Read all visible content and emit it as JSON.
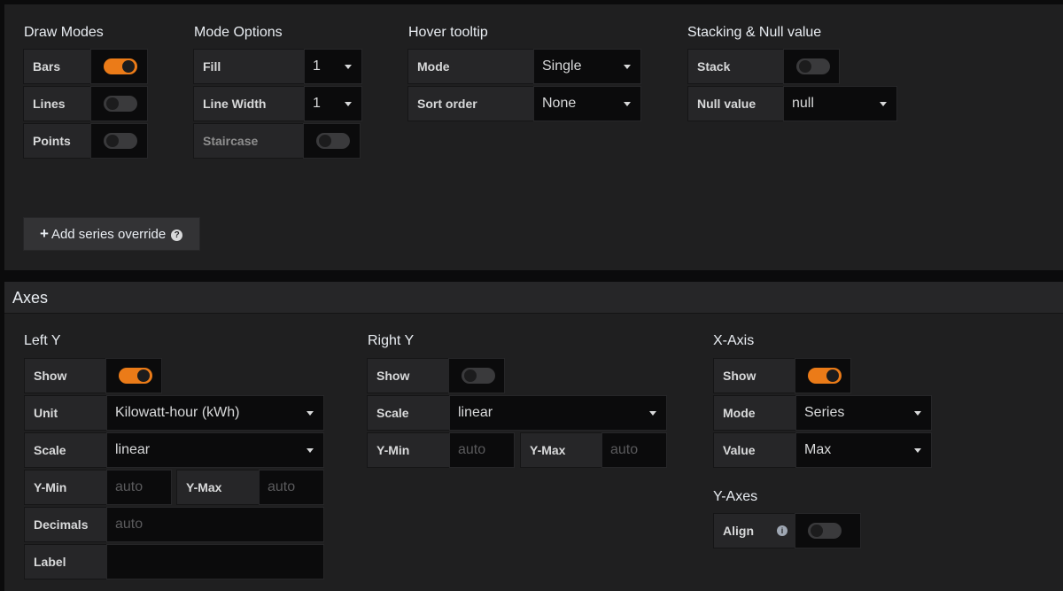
{
  "draw_modes": {
    "title": "Draw Modes",
    "bars_label": "Bars",
    "bars_on": true,
    "lines_label": "Lines",
    "lines_on": false,
    "points_label": "Points",
    "points_on": false
  },
  "mode_options": {
    "title": "Mode Options",
    "fill_label": "Fill",
    "fill_value": "1",
    "line_width_label": "Line Width",
    "line_width_value": "1",
    "staircase_label": "Staircase",
    "staircase_on": false
  },
  "hover_tooltip": {
    "title": "Hover tooltip",
    "mode_label": "Mode",
    "mode_value": "Single",
    "sort_label": "Sort order",
    "sort_value": "None"
  },
  "stacking": {
    "title": "Stacking & Null value",
    "stack_label": "Stack",
    "stack_on": false,
    "null_label": "Null value",
    "null_value": "null"
  },
  "add_override": {
    "label": "Add series override",
    "icon": "question-circle-icon"
  },
  "axes": {
    "title": "Axes",
    "left_y": {
      "title": "Left Y",
      "show_label": "Show",
      "show_on": true,
      "unit_label": "Unit",
      "unit_value": "Kilowatt-hour (kWh)",
      "scale_label": "Scale",
      "scale_value": "linear",
      "ymin_label": "Y-Min",
      "ymin_placeholder": "auto",
      "ymax_label": "Y-Max",
      "ymax_placeholder": "auto",
      "decimals_label": "Decimals",
      "decimals_placeholder": "auto",
      "label_label": "Label",
      "label_value": ""
    },
    "right_y": {
      "title": "Right Y",
      "show_label": "Show",
      "show_on": false,
      "scale_label": "Scale",
      "scale_value": "linear",
      "ymin_label": "Y-Min",
      "ymin_placeholder": "auto",
      "ymax_label": "Y-Max",
      "ymax_placeholder": "auto"
    },
    "x_axis": {
      "title": "X-Axis",
      "show_label": "Show",
      "show_on": true,
      "mode_label": "Mode",
      "mode_value": "Series",
      "value_label": "Value",
      "value_value": "Max"
    },
    "y_axes": {
      "title": "Y-Axes",
      "align_label": "Align",
      "align_on": false
    }
  },
  "colors": {
    "accent": "#eb7b18",
    "panel": "#1f1f20",
    "input_bg": "#0b0b0c",
    "label_bg": "#262628"
  }
}
